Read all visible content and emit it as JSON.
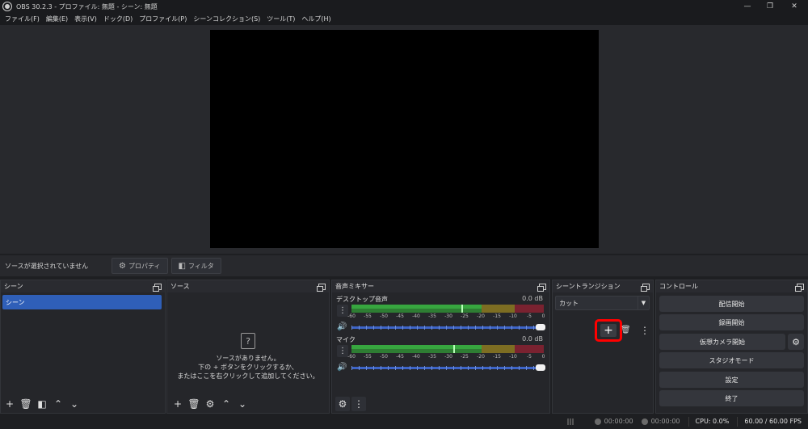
{
  "window": {
    "title": "OBS 30.2.3 - プロファイル: 無題 - シーン: 無題",
    "minimize": "—",
    "restore": "❐",
    "close": "✕"
  },
  "menu": [
    "ファイル(F)",
    "編集(E)",
    "表示(V)",
    "ドック(D)",
    "プロファイル(P)",
    "シーンコレクション(S)",
    "ツール(T)",
    "ヘルプ(H)"
  ],
  "context_bar": {
    "no_source": "ソースが選択されていません",
    "properties": "プロパティ",
    "filters": "フィルタ"
  },
  "scenes": {
    "title": "シーン",
    "items": [
      "シーン"
    ]
  },
  "sources": {
    "title": "ソース",
    "empty_icon": "?",
    "empty_line1": "ソースがありません。",
    "empty_line2": "下の + ボタンをクリックするか、",
    "empty_line3": "またはここを右クリックして追加してください。"
  },
  "mixer": {
    "title": "音声ミキサー",
    "channels": [
      {
        "name": "デスクトップ音声",
        "db": "0.0 dB",
        "level": 1.0
      },
      {
        "name": "マイク",
        "db": "0.0 dB",
        "level": 1.0
      }
    ],
    "ticks": [
      "-60",
      "-55",
      "-50",
      "-45",
      "-40",
      "-35",
      "-30",
      "-25",
      "-20",
      "-15",
      "-10",
      "-5",
      "0"
    ]
  },
  "transitions": {
    "title": "シーントランジション",
    "selected": "カット"
  },
  "controls": {
    "title": "コントロール",
    "start_streaming": "配信開始",
    "start_recording": "録画開始",
    "virtual_camera": "仮想カメラ開始",
    "studio_mode": "スタジオモード",
    "settings": "設定",
    "exit": "終了"
  },
  "status": {
    "stream_time": "00:00:00",
    "record_time": "00:00:00",
    "cpu": "CPU: 0.0%",
    "fps": "60.00 / 60.00 FPS"
  }
}
